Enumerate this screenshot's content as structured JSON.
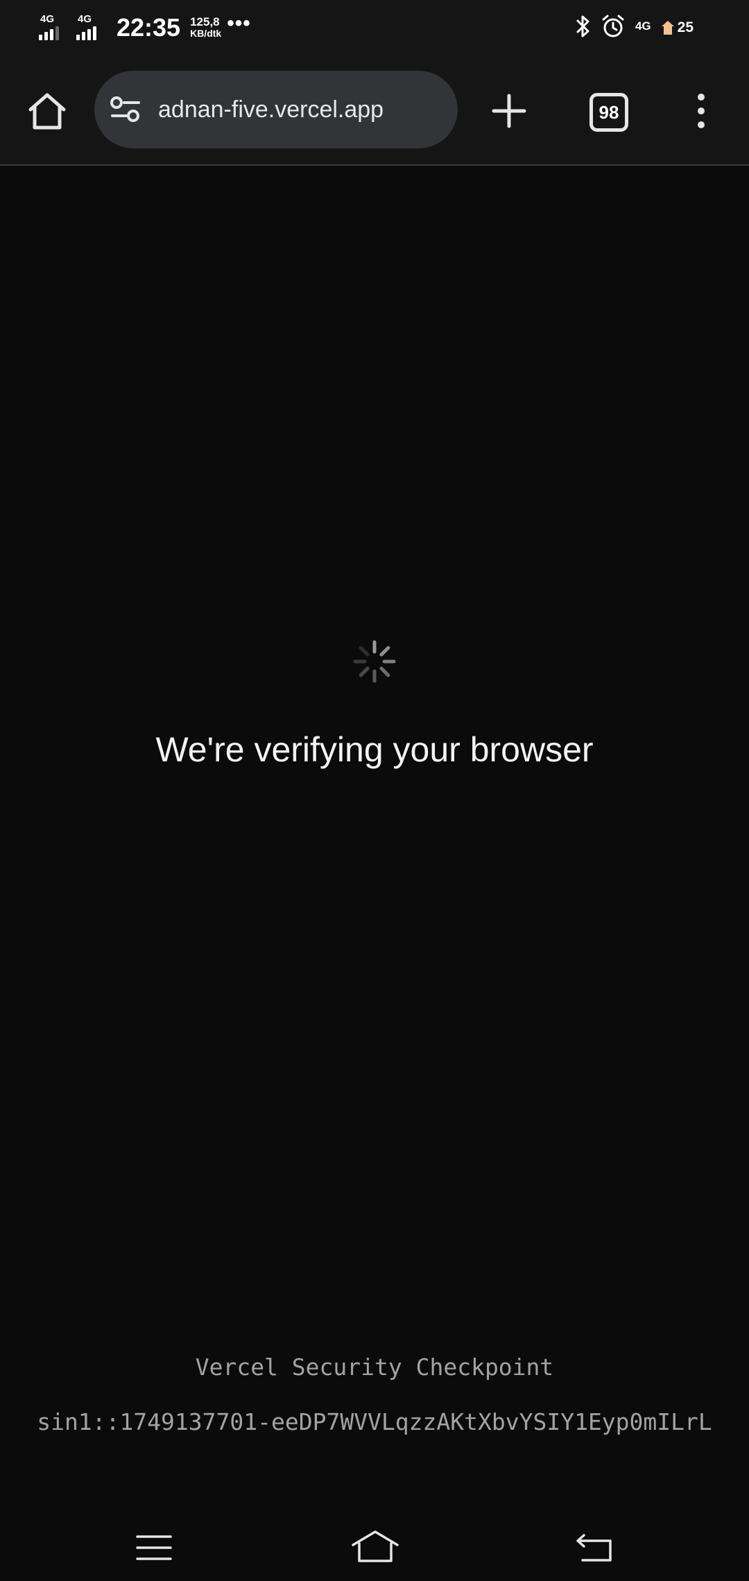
{
  "status_bar": {
    "sim1_label": "4G",
    "sim2_label": "4G",
    "time": "22:35",
    "speed_value": "125,8",
    "speed_unit": "KB/dtk",
    "more": "•••",
    "network_label": "4G",
    "battery": "25",
    "icons": [
      "bluetooth-icon",
      "alarm-icon",
      "battery-saver-icon"
    ]
  },
  "toolbar": {
    "url": "adnan-five.vercel.app",
    "tab_count": "98",
    "icons": [
      "home-icon",
      "site-settings-icon",
      "plus-icon",
      "kebab-menu-icon"
    ]
  },
  "page": {
    "heading": "We're verifying your browser",
    "checkpoint_title": "Vercel Security Checkpoint",
    "request_id": "sin1::1749137701-eeDP7WVVLqzzAKtXbvYSIY1Eyp0mILrL"
  },
  "nav_bar": {
    "icons": [
      "recents-icon",
      "home-icon",
      "back-icon"
    ]
  },
  "colors": {
    "background": "#0b0b0c",
    "chrome": "#151515",
    "url_bar": "#333437",
    "muted_text": "#a3a3a3"
  }
}
